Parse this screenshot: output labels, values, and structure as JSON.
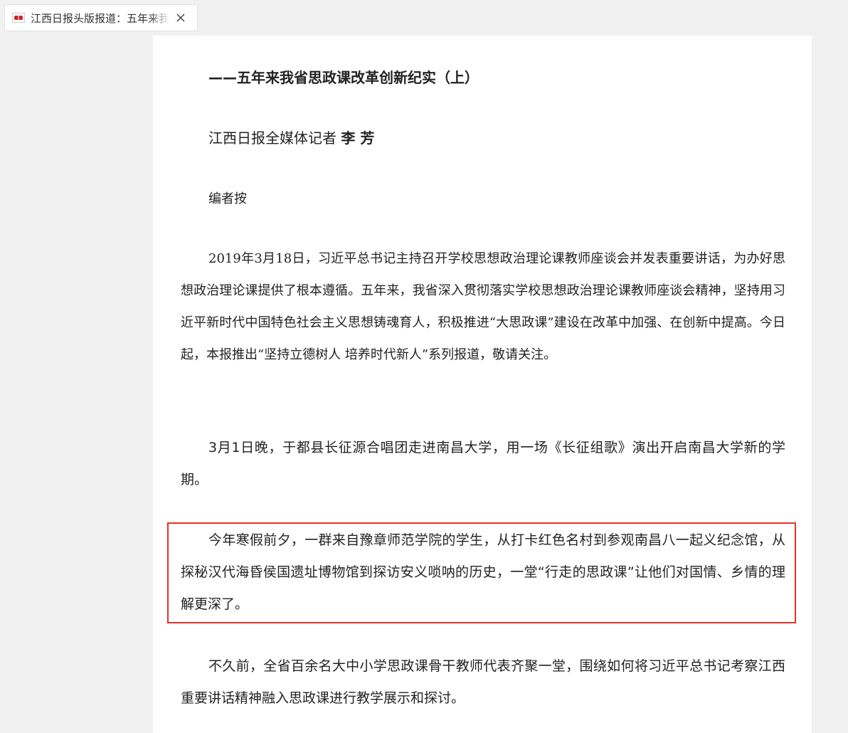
{
  "tab": {
    "title": "江西日报头版报道：五年来我省思政课改革创新纪实（上）",
    "favicon": "jiangxi-daily-logo",
    "close_icon": "close-icon"
  },
  "article": {
    "subtitle": "——五年来我省思政课改革创新纪实（上）",
    "byline_prefix": "江西日报全媒体记者",
    "byline_name": "李 芳",
    "editor_note_label": "编者按",
    "editor_note_body": "2019年3月18日，习近平总书记主持召开学校思想政治理论课教师座谈会并发表重要讲话，为办好思想政治理论课提供了根本遵循。五年来，我省深入贯彻落实学校思想政治理论课教师座谈会精神，坚持用习近平新时代中国特色社会主义思想铸魂育人，积极推进“大思政课”建设在改革中加强、在创新中提高。今日起，本报推出“坚持立德树人 培养时代新人”系列报道，敬请关注。",
    "paragraph1": "3月1日晚，于都县长征源合唱团走进南昌大学，用一场《长征组歌》演出开启南昌大学新的学期。",
    "paragraph2": "今年寒假前夕，一群来自豫章师范学院的学生，从打卡红色名村到参观南昌八一起义纪念馆，从探秘汉代海昏侯国遗址博物馆到探访安义唢呐的历史，一堂“行走的思政课”让他们对国情、乡情的理解更深了。",
    "paragraph3": "不久前，全省百余名大中小学思政课骨干教师代表齐聚一堂，围绕如何将习近平总书记考察江西重要讲话精神融入思政课进行教学展示和探讨。"
  },
  "colors": {
    "highlight_border": "#e8312a",
    "background": "#f1f1f1",
    "page": "#ffffff"
  }
}
